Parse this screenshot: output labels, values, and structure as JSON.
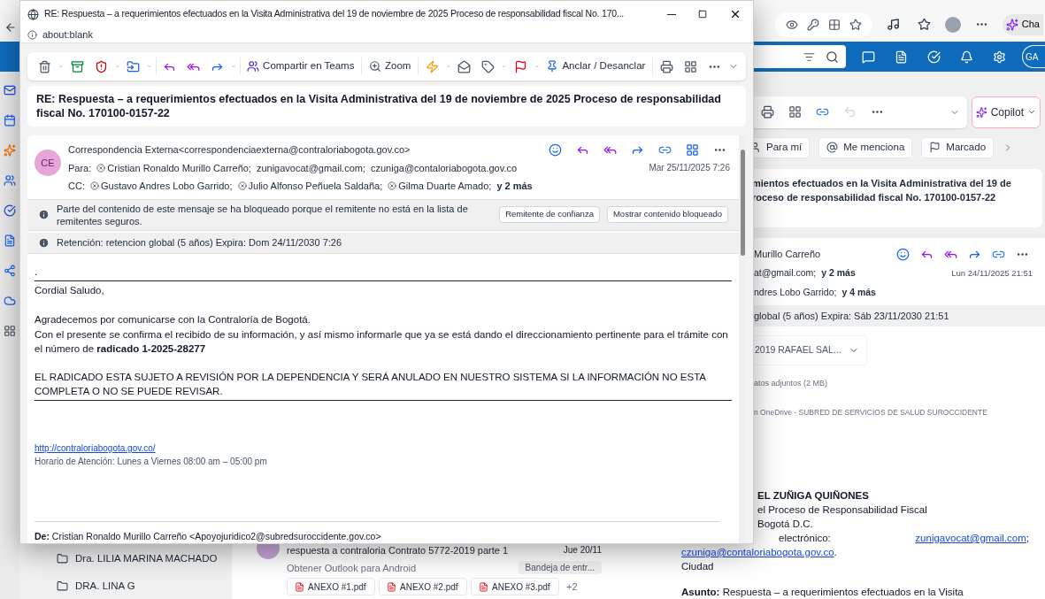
{
  "popup": {
    "title": "RE: Respuesta – a requerimientos efectuados en la Visita Administrativa del 19 de noviembre de 2025 Proceso de responsabilidad fiscal No. 170...",
    "address": "about:blank",
    "toolbar_buttons": [
      "Compartir en Teams",
      "Zoom",
      "Anclar / Desanclar"
    ],
    "subject": "RE: Respuesta – a requerimientos efectuados en la Visita Administrativa del 19 de noviembre de 2025 Proceso de responsabilidad fiscal No. 170100-0157-22",
    "avatar": "CE",
    "sender": "Correspondencia Externa<correspondenciaexterna@contraloriabogota.gov.co>",
    "to_label": "Para:",
    "to": [
      "Cristian Ronaldo Murillo Carreño;",
      "zunigavocat@gmail.com;",
      "czuniga@contaloriabogota.gov.co"
    ],
    "cc_label": "CC:",
    "cc": [
      "Gustavo Andres Lobo Garrido;",
      "Julio Alfonso Peñuela Saldaña;",
      "Gilma Duarte Amado;"
    ],
    "cc_more": "y 2 más",
    "date": "Mar 25/11/2025 7:26",
    "notice": "Parte del contenido de este mensaje se ha bloqueado porque el remitente no está en la lista de remitentes seguros.",
    "notice_buttons": [
      "Remitente de confianza",
      "Mostrar contenido bloqueado"
    ],
    "retention": "Retención: retencion global (5 años) Expira: Dom 24/11/2030 7:26",
    "body": {
      "dot": ".",
      "greeting": "Cordial Saludo,",
      "thanks": "Agradecemos por comunicarse con la Contraloría de Bogotá.",
      "confirm": "Con el presente se confirma el recibido de su información, y así mismo informarle que ya se está dando el direccionamiento pertinente para el trámite con el número de **radicado 1-2025-28277**",
      "warning": "EL RADICADO ESTA SUJETO A REVISIÓN POR LA DEPENDENCIA Y SERÁ ANULADO EN NUESTRO SISTEMA SI LA INFORMACIÓN NO ESTA COMPLETA O NO SE PUEDE REVISAR.",
      "link": "http://contraloriabogota.gov.co/",
      "hours": "Horario de Atención:  Lunes a Viernes 08:00 am – 05:00 pm"
    },
    "from_line": "**De:** Cristian Ronaldo Murillo Carreño <Apoyojuridico2@subredsuroccidente.gov.co>"
  },
  "background": {
    "browser_tab": "Cha",
    "account": "GA",
    "copilot": "Copilot",
    "filters": [
      "Para mí",
      "Me menciona",
      "Marcado"
    ],
    "subject_lines": [
      "mientos efectuados en la Visita Administrativa del 19 de",
      "roceso de responsabilidad fiscal No. 170100-0157-22"
    ],
    "sender": "Murillo Carreño",
    "to": "at@gmail.com;",
    "to_more": "y 2 más",
    "date": "Lun 24/11/2025 21:51",
    "cc": "ndres Lobo Garrido;",
    "cc_more": "y 4 más",
    "retention": "global (5 años) Expira: Sáb 23/11/2030 21:51",
    "attachment": "2019 RAFAEL SAL...",
    "attachments_size": "atos adjuntos (2 MB)",
    "onedrive": "n OneDrive - SUBRED DE SERVICIOS DE SALUD SUROCCIDENTE",
    "letter": {
      "name": "EL ZUÑIGA QUIÑONES",
      "role": "el Proceso de Responsabilidad Fiscal",
      "city": "Bogotá D.C.",
      "email_label": "electrónico:",
      "email1": "zunigavocat@gmail.com",
      "sep1": ";",
      "email2": "czuniga@contaloriabogota.gov.co",
      "sep2": ".",
      "ciudad": "Ciudad",
      "asunto": "**Asunto:** Respuesta – a requerimientos efectuados en la Visita"
    },
    "folders": [
      "Dra. LILIA MARINA MACHADO",
      "DRA. LINA G"
    ],
    "message": {
      "subject": "respuesta a contraloria Contrato 5772-2019 parte 1",
      "date": "Jue 20/11",
      "preview": "Obtener Outlook para Android",
      "folder": "Bandeja de entr...",
      "attachments": [
        "ANEXO #1.pdf",
        "ANEXO #2.pdf",
        "ANEXO #3.pdf"
      ],
      "more": "+2"
    }
  }
}
